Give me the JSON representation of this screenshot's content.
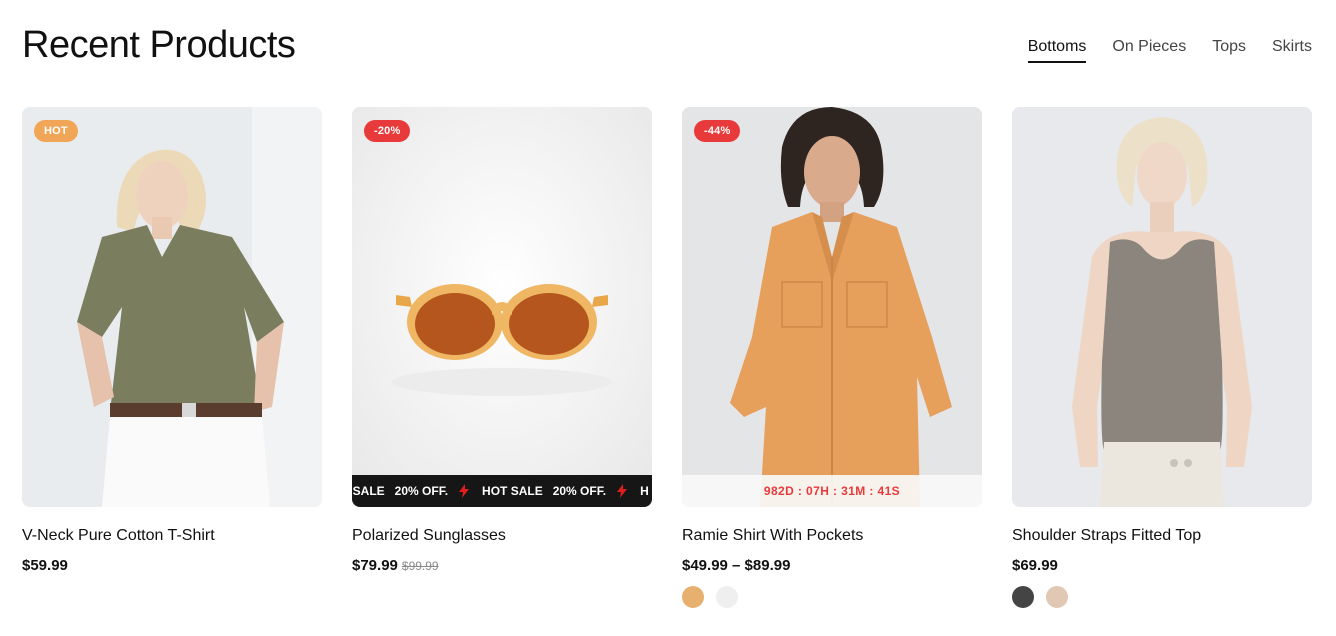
{
  "header": {
    "title": "Recent Products"
  },
  "tabs": [
    {
      "label": "Bottoms",
      "active": true
    },
    {
      "label": "On Pieces",
      "active": false
    },
    {
      "label": "Tops",
      "active": false
    },
    {
      "label": "Skirts",
      "active": false
    }
  ],
  "products": [
    {
      "badge": "HOT",
      "title": "V-Neck Pure Cotton T-Shirt",
      "price": "$59.99"
    },
    {
      "badge": "-20%",
      "title": "Polarized Sunglasses",
      "price": "$79.99",
      "old_price": "$99.99",
      "marquee": {
        "hot": "HOT SALE",
        "off": "20% OFF.",
        "cut_lead": "T SALE",
        "cut_tail": "H"
      }
    },
    {
      "badge": "-44%",
      "title": "Ramie Shirt With Pockets",
      "price": "$49.99 – $89.99",
      "countdown": "982D : 07H : 31M : 41S",
      "swatches": [
        "#e8b06e",
        "#efefef"
      ]
    },
    {
      "title": "Shoulder Straps Fitted Top",
      "price": "$69.99",
      "swatches": [
        "#444444",
        "#e1c8b4"
      ]
    }
  ],
  "colors": {
    "hot_badge": "#f0a656",
    "sale_badge": "#e83a3a",
    "countdown_text": "#e83a3a",
    "bolt": "#e11d1d"
  },
  "icons": {
    "marquee": "lightning-bolt-icon"
  }
}
